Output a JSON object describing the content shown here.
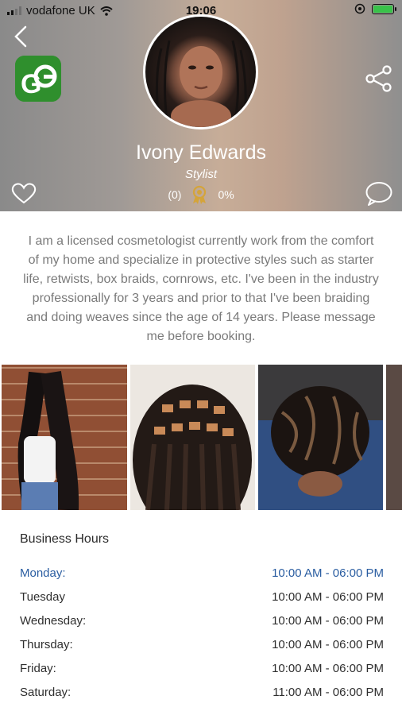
{
  "status_bar": {
    "carrier": "vodafone UK",
    "time": "19:06",
    "battery_color": "#39c24a"
  },
  "header": {
    "back_icon": "chevron-left-icon",
    "brand_logo_text": "G",
    "share_icon": "share-icon",
    "profile": {
      "name": "Ivony Edwards",
      "role": "Stylist",
      "review_count": "(0)",
      "rating": "0%"
    },
    "heart_icon": "heart-icon",
    "chat_icon": "chat-bubble-icon"
  },
  "bio": "I am a licensed cosmetologist currently work from the comfort of my home and specialize in protective styles such as starter life, retwists, box braids, cornrows, etc. I've been in the industry professionally for 3 years and prior to that I've been braiding and doing weaves since the age of 14 years. Please message me before booking.",
  "gallery": {
    "photos": [
      "box-braids-photo",
      "knotless-braids-photo",
      "loc-retwist-photo",
      "partial-photo"
    ]
  },
  "business_hours": {
    "title": "Business Hours",
    "rows": [
      {
        "day": "Monday:",
        "hours": "10:00 AM - 06:00 PM"
      },
      {
        "day": "Tuesday",
        "hours": "10:00 AM - 06:00 PM"
      },
      {
        "day": "Wednesday:",
        "hours": "10:00 AM - 06:00 PM"
      },
      {
        "day": "Thursday:",
        "hours": "10:00 AM - 06:00 PM"
      },
      {
        "day": "Friday:",
        "hours": "10:00 AM - 06:00 PM"
      },
      {
        "day": "Saturday:",
        "hours": "11:00 AM - 06:00 PM"
      }
    ]
  },
  "colors": {
    "accent": "#2a5da1",
    "brand_green": "#2f8f2d",
    "badge_gold": "#d4a43a"
  }
}
